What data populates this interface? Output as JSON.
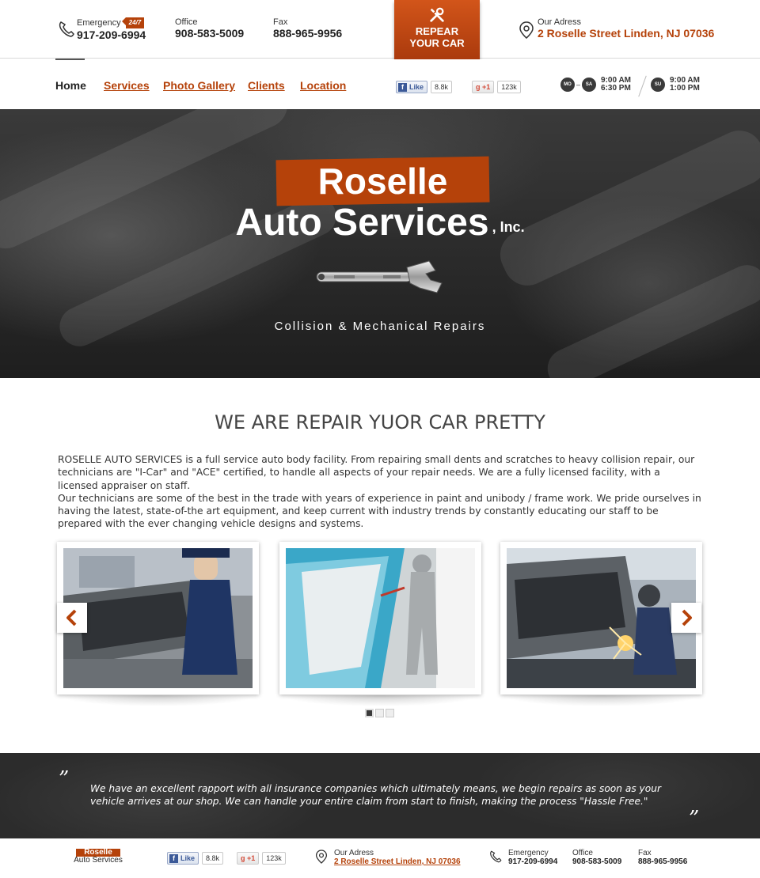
{
  "header": {
    "emergency": {
      "label": "Emergency",
      "badge": "24/7",
      "phone": "917-209-6994"
    },
    "office": {
      "label": "Office",
      "phone": "908-583-5009"
    },
    "fax": {
      "label": "Fax",
      "phone": "888-965-9956"
    },
    "repair_button": {
      "line1": "REPEAR",
      "line2": "YOUR CAR"
    },
    "address": {
      "label": "Our Adress",
      "value": "2 Roselle Street Linden, NJ 07036"
    }
  },
  "nav": {
    "items": [
      {
        "label": "Home",
        "active": true
      },
      {
        "label": "Services"
      },
      {
        "label": "Photo Gallery"
      },
      {
        "label": "Clients"
      },
      {
        "label": "Location"
      }
    ]
  },
  "social": {
    "facebook": {
      "label": "Like",
      "count": "8.8k"
    },
    "gplus": {
      "label": "+1",
      "count": "123k"
    }
  },
  "hours": {
    "weekdays": {
      "from_day": "MO",
      "to_day": "SA",
      "open": "9:00 AM",
      "close": "6:30 PM"
    },
    "sunday": {
      "day": "SU",
      "open": "9:00 AM",
      "close": "1:00 PM"
    }
  },
  "hero": {
    "title_line1": "Roselle",
    "title_line2": "Auto Services",
    "suffix": ", Inc.",
    "tagline": "Collision & Mechanical Repairs"
  },
  "about": {
    "heading": "WE ARE REPAIR YUOR CAR PRETTY",
    "paragraph1": "ROSELLE AUTO SERVICES is a full service auto body facility. From repairing small dents and scratches to heavy collision repair, our technicians are \"I-Car\" and \"ACE\" certified, to handle all aspects of your repair needs. We are a fully licensed facility, with a licensed appraiser on staff.",
    "paragraph2": "Our technicians are some of the best in the trade with years of experience in paint and unibody / frame work. We pride ourselves in having the latest, state-of-the art equipment, and keep current with industry trends by constantly educating our staff to be prepared with the ever changing vehicle designs and systems."
  },
  "gallery": {
    "active_slide": 1,
    "slide_count": 3
  },
  "testimonial": {
    "open_quote": "”",
    "close_quote": "”",
    "text": "We have an excellent rapport with all insurance companies which ultimately means, we begin repairs as soon as your vehicle arrives at our shop. We can handle your entire claim from start to finish, making the process \"Hassle Free.\""
  },
  "footer": {
    "logo_top": "Roselle",
    "logo_bottom": "Auto Services",
    "facebook": {
      "label": "Like",
      "count": "8.8k"
    },
    "gplus": {
      "label": "+1",
      "count": "123k"
    },
    "address": {
      "label": "Our Adress",
      "value": "2 Roselle Street Linden, NJ 07036"
    },
    "emergency": {
      "label": "Emergency",
      "phone": "917-209-6994"
    },
    "office": {
      "label": "Office",
      "phone": "908-583-5009"
    },
    "fax": {
      "label": "Fax",
      "phone": "888-965-9956"
    }
  },
  "colors": {
    "accent": "#b5420a",
    "dark": "#2c2c2c",
    "text": "#333333"
  }
}
